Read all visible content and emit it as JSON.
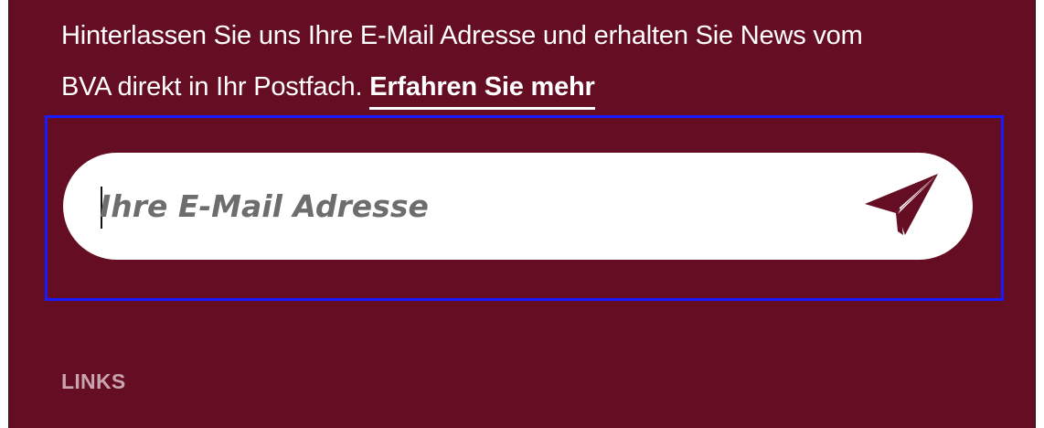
{
  "newsletter": {
    "intro_line1": "Hinterlassen Sie uns Ihre E-Mail Adresse und erhalten Sie News vom",
    "intro_line2": "BVA direkt in Ihr Postfach.",
    "learn_more_link": "Erfahren Sie mehr",
    "email_placeholder": "Ihre E-Mail Adresse",
    "submit_icon": "paper-plane-icon"
  },
  "footer": {
    "links_heading": "LINKS"
  },
  "colors": {
    "background": "#650d23",
    "text": "#ffffff",
    "accent": "#650d23",
    "placeholder": "#6d6d6d",
    "muted_heading": "#c9a3ae",
    "focus_outline": "#1a1aff"
  }
}
